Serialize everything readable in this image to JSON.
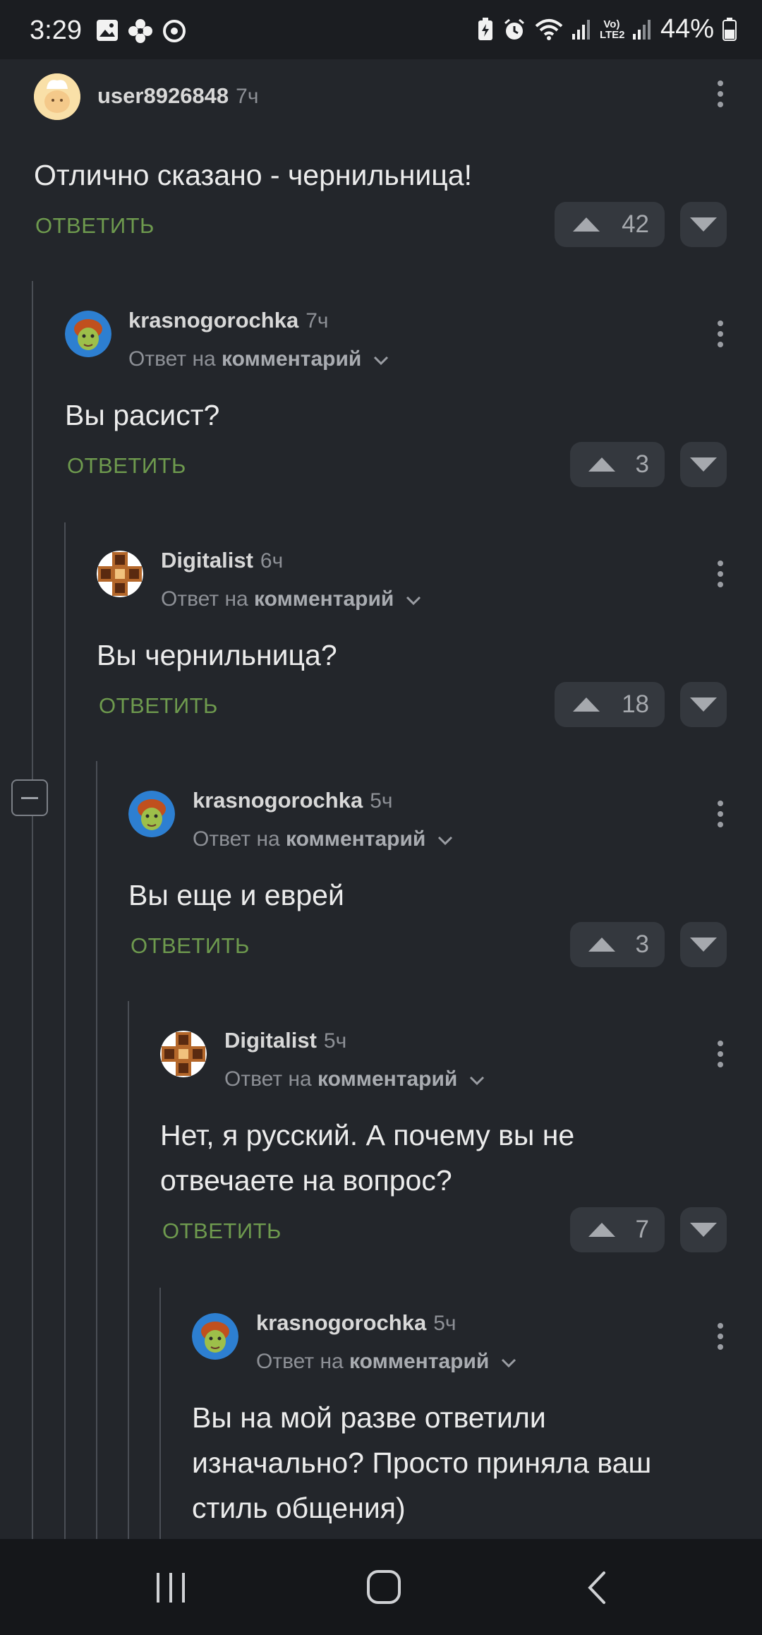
{
  "status": {
    "time": "3:29",
    "battery": "44%",
    "net_label": "Vo) LTE2"
  },
  "comments": [
    {
      "user": "user8926848",
      "time": "7ч",
      "reply_prefix": "",
      "reply_target": "",
      "text": "Отлично сказано - чернильница!",
      "reply_label": "ОТВЕТИТЬ",
      "votes": "42",
      "avatar": "cook"
    },
    {
      "user": "krasnogorochka",
      "time": "7ч",
      "reply_prefix": "Ответ на",
      "reply_target": "комментарий",
      "text": "Вы расист?",
      "reply_label": "ОТВЕТИТЬ",
      "votes": "3",
      "avatar": "fiona"
    },
    {
      "user": "Digitalist",
      "time": "6ч",
      "reply_prefix": "Ответ на",
      "reply_target": "комментарий",
      "text": "Вы чернильница?",
      "reply_label": "ОТВЕТИТЬ",
      "votes": "18",
      "avatar": "cross"
    },
    {
      "user": "krasnogorochka",
      "time": "5ч",
      "reply_prefix": "Ответ на",
      "reply_target": "комментарий",
      "text": "Вы еще и еврей",
      "reply_label": "ОТВЕТИТЬ",
      "votes": "3",
      "avatar": "fiona"
    },
    {
      "user": "Digitalist",
      "time": "5ч",
      "reply_prefix": "Ответ на",
      "reply_target": "комментарий",
      "text_lines": [
        "Нет, я русский. А почему вы не",
        "отвечаете на вопрос?"
      ],
      "reply_label": "ОТВЕТИТЬ",
      "votes": "7",
      "avatar": "cross"
    },
    {
      "user": "krasnogorochka",
      "time": "5ч",
      "reply_prefix": "Ответ на",
      "reply_target": "комментарий",
      "text_lines": [
        "Вы на мой разве ответили",
        "изначально? Просто приняла ваш",
        "стиль общения)"
      ],
      "avatar": "fiona"
    }
  ],
  "nav": {
    "recents": "recents-icon",
    "home": "home-icon",
    "back": "back-icon"
  },
  "colors": {
    "background": "#23262b",
    "accent": "#6e9a4e",
    "vote_bg": "#34383e"
  }
}
